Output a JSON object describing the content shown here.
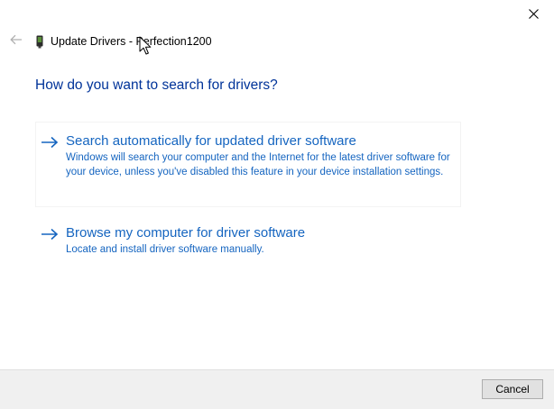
{
  "window": {
    "title": "Update Drivers - Perfection1200"
  },
  "icons": {
    "close": "close-icon",
    "back": "back-arrow-icon",
    "device": "device-icon",
    "option_arrow": "right-arrow-icon",
    "cursor": "mouse-pointer-icon"
  },
  "main": {
    "question": "How do you want to search for drivers?",
    "options": [
      {
        "title": "Search automatically for updated driver software",
        "description": "Windows will search your computer and the Internet for the latest driver software for your device, unless you've disabled this feature in your device installation settings."
      },
      {
        "title": "Browse my computer for driver software",
        "description": "Locate and install driver software manually."
      }
    ]
  },
  "footer": {
    "cancel_label": "Cancel"
  },
  "colors": {
    "link_blue": "#1565c0",
    "heading_blue": "#003399",
    "footer_bg": "#f0f0f0",
    "button_bg": "#e1e1e1"
  }
}
